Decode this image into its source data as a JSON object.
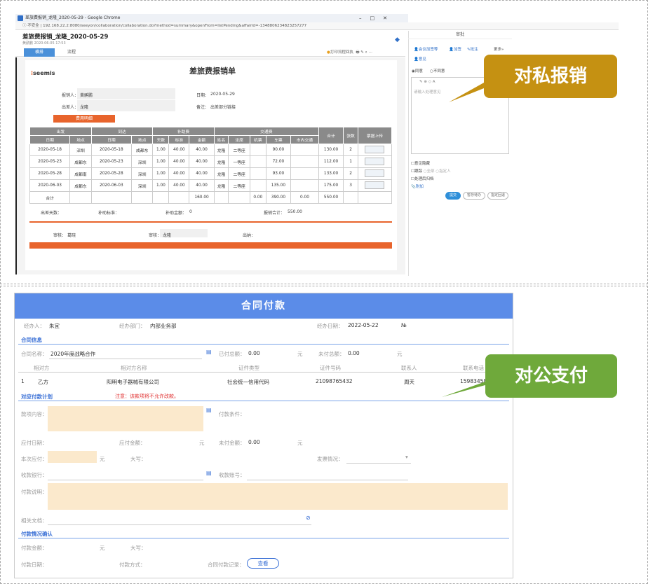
{
  "top": {
    "window_title": "差旅费报销_龙隆_2020-05-29 - Google Chrome",
    "url": "ⓘ 不安全 | 192.168.22.2:8080/seeyon/collaboration/collaboration.do?method=summary&openFrom=listPending&affairId=-1348806234823257277",
    "doc_title": "差旅费报销_龙隆_2020-05-29",
    "doc_sub": "黄鹂鹏 2020-06-05 17:53",
    "tab_main": "横排",
    "tab_other": "流程",
    "toolbar_text": "打印流程回执",
    "form_title": "差旅费报销单",
    "logo_text": "seemis",
    "reimburser_label": "报销人：",
    "reimburser_value": "黄鹂鹏",
    "traveler_label": "出差人：",
    "traveler_value": "龙隆",
    "date_label": "日期：",
    "date_value": "2020-05-29",
    "note_label": "备注：",
    "note_value": "出差部分链接",
    "detail_bar": "费用明细",
    "group_headers": [
      "出发",
      "到达",
      "补助费",
      "交通费"
    ],
    "col_headers": [
      "日期",
      "地点",
      "日期",
      "地点",
      "天数",
      "标准",
      "金额",
      "姓名",
      "坐席",
      "机票",
      "车票",
      "市内交通",
      "合计",
      "张数",
      "票据上传"
    ],
    "rows": [
      [
        "2020-05-18",
        "深圳",
        "2020-05-18",
        "成都东",
        "1.00",
        "40.00",
        "40.00",
        "龙隆",
        "二等座",
        "",
        "90.00",
        "",
        "130.00",
        "2"
      ],
      [
        "2020-05-23",
        "成都东",
        "2020-05-23",
        "深圳",
        "1.00",
        "40.00",
        "40.00",
        "龙隆",
        "一等座",
        "",
        "72.00",
        "",
        "112.00",
        "1"
      ],
      [
        "2020-05-28",
        "成都南",
        "2020-05-28",
        "深圳",
        "1.00",
        "40.00",
        "40.00",
        "龙隆",
        "二等座",
        "",
        "93.00",
        "",
        "133.00",
        "2"
      ],
      [
        "2020-06-03",
        "成都东",
        "2020-06-03",
        "深圳",
        "1.00",
        "40.00",
        "40.00",
        "龙隆",
        "二等座",
        "",
        "135.00",
        "",
        "175.00",
        "3"
      ]
    ],
    "sum_label": "合计",
    "sum_allow": "160.00",
    "sum_plane": "0.00",
    "sum_train": "390.00",
    "sum_city": "0.00",
    "sum_total": "550.00",
    "days_label": "出差天数：",
    "std_label": "补助标准：",
    "allow_label": "补助金额：",
    "allow_value": "0",
    "total_label": "报销合计：",
    "total_value": "550.00",
    "approve_label": "审核：",
    "approve_value": "葛晓",
    "check_label": "审核：",
    "check_value": "龙隆",
    "cashier_label": "出纳：",
    "right_head": "审批",
    "right_opts": [
      "会议加签等",
      "加签",
      "批注",
      "更多"
    ],
    "right_sub": "意见",
    "agree": "同意",
    "disagree": "不同意",
    "opinion_placeholder": "请输入处理意见",
    "chk1": "意见隐藏",
    "chk2": "跟踪",
    "chk2a": "全部",
    "chk2b": "指定人",
    "chk3": "处理后归档",
    "attach": "附加",
    "btn_submit": "提交",
    "btn_hold": "暂存待办",
    "btn_other": "指定回退"
  },
  "callout_private": "对私报销",
  "callout_public": "对公支付",
  "bottom": {
    "header": "合同付款",
    "handler_label": "经办人：",
    "handler_value": "朱宜",
    "dept_label": "经办部门：",
    "dept_value": "内部业务部",
    "date_label": "经办日期：",
    "date_value": "2022-05-22",
    "no_label": "№",
    "sect_contract": "合同信息",
    "contract_name_label": "合同名称：",
    "contract_name_value": "2020年度战略合作",
    "paid_label": "已付总额：",
    "paid_value": "0.00",
    "unpaid_label": "未付总额：",
    "unpaid_value": "0.00",
    "yuan": "元",
    "cols": [
      "相对方",
      "相对方名称",
      "证件类型",
      "证件号码",
      "联系人",
      "联系电话"
    ],
    "row_no": "1",
    "row_party": "乙方",
    "row_name": "阳明电子器械有限公司",
    "row_type": "社会统一信用代码",
    "row_id": "2109876543​2",
    "row_contact": "周天",
    "row_phone": "15983458",
    "sect_plan": "对应付款计划",
    "plan_warn": "注意：该款项将不允许改款。",
    "content_label": "款项内容：",
    "cond_label": "付款条件：",
    "due_date_label": "应付日期：",
    "due_amt_label": "应付金额：",
    "unpaid2_label": "未付金额：",
    "unpaid2_value": "0.00",
    "this_pay_label": "本次应付：",
    "upper_label": "大写：",
    "invoice_label": "发票情况：",
    "bank_label": "收款银行：",
    "account_label": "收款账号：",
    "desc_label": "付款说明：",
    "rel_doc_label": "相关文档：",
    "sect_confirm": "付款情况确认",
    "pay_amt_label": "付款金额：",
    "upper2_label": "大写：",
    "pay_date_label": "付款日期：",
    "pay_method_label": "付款方式：",
    "record_label": "合同付款记录：",
    "view_btn": "查看"
  }
}
